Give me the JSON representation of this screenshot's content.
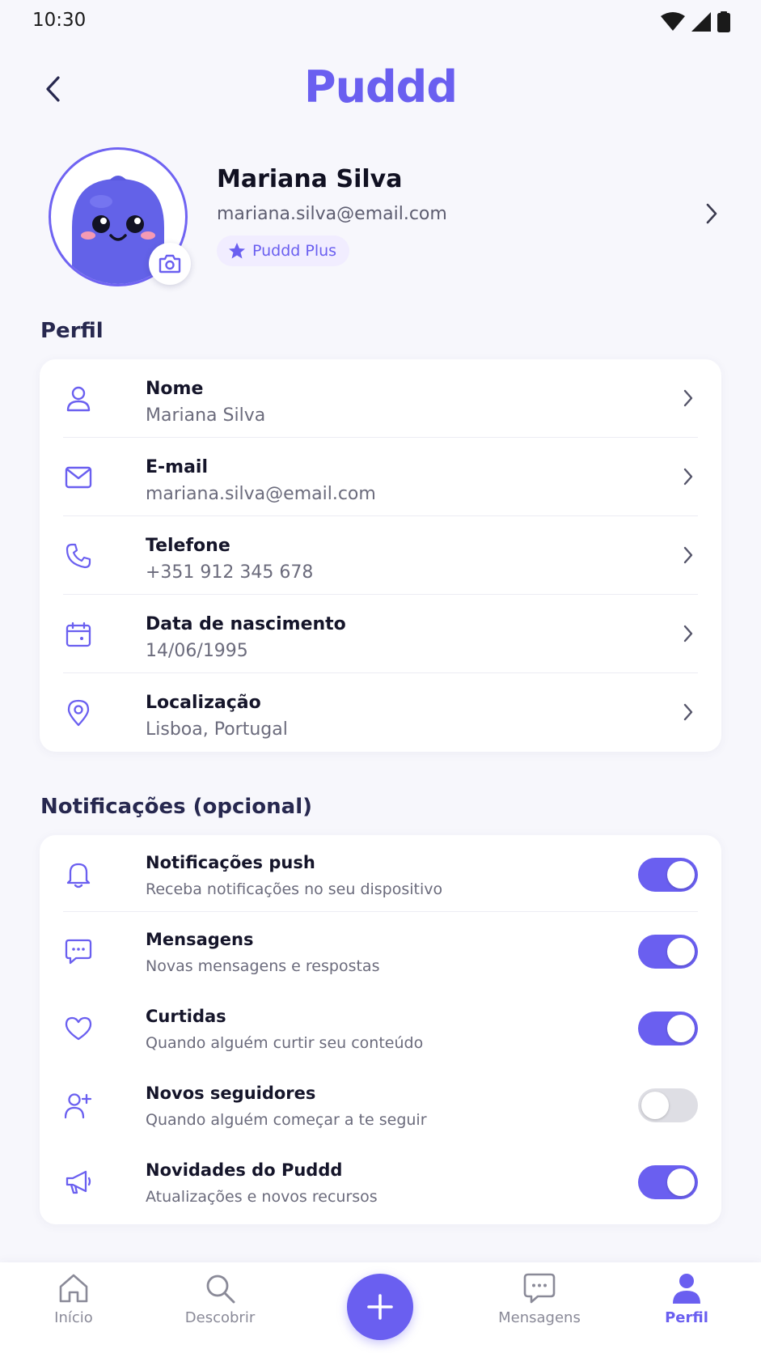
{
  "status_bar": {
    "time": "10:30"
  },
  "header": {
    "title": "Puddd"
  },
  "profile": {
    "name": "Mariana Silva",
    "email": "mariana.silva@email.com",
    "badge": "Puddd Plus"
  },
  "perfil_section": {
    "title": "Perfil",
    "items": [
      {
        "label": "Nome",
        "value": "Mariana Silva",
        "icon": "user-icon"
      },
      {
        "label": "E-mail",
        "value": "mariana.silva@email.com",
        "icon": "mail-icon"
      },
      {
        "label": "Telefone",
        "value": "+351 912 345 678",
        "icon": "phone-icon"
      },
      {
        "label": "Data de nascimento",
        "value": "14/06/1995",
        "icon": "calendar-icon"
      },
      {
        "label": "Localização",
        "value": "Lisboa, Portugal",
        "icon": "location-pin-icon"
      }
    ]
  },
  "notifications_section": {
    "title": "Notificações (opcional)",
    "items": [
      {
        "label": "Notificações push",
        "description": "Receba notificações no seu dispositivo",
        "icon": "bell-icon",
        "enabled": true
      },
      {
        "label": "Mensagens",
        "description": "Novas mensagens e respostas",
        "icon": "chat-bubble-icon",
        "enabled": true
      },
      {
        "label": "Curtidas",
        "description": "Quando alguém curtir seu conteúdo",
        "icon": "heart-icon",
        "enabled": true
      },
      {
        "label": "Novos seguidores",
        "description": "Quando alguém começar a te seguir",
        "icon": "user-plus-icon",
        "enabled": false
      },
      {
        "label": "Novidades do Puddd",
        "description": "Atualizações e novos recursos",
        "icon": "megaphone-icon",
        "enabled": true
      }
    ]
  },
  "bottom_nav": {
    "items": [
      {
        "label": "Início",
        "icon": "home-icon",
        "active": false
      },
      {
        "label": "Descobrir",
        "icon": "search-icon",
        "active": false
      },
      {
        "label": "Mensagens",
        "icon": "chat-bubble-icon",
        "active": false
      },
      {
        "label": "Perfil",
        "icon": "user-icon",
        "active": true
      }
    ],
    "fab_icon": "plus-icon"
  },
  "colors": {
    "accent": "#6a5ff0",
    "toggle_off": "#dedee4",
    "background": "#f7f7fc"
  }
}
